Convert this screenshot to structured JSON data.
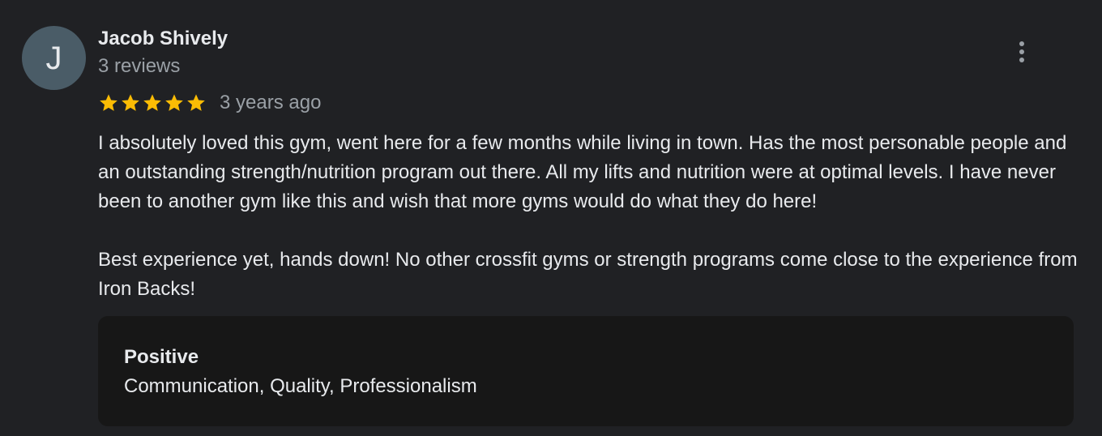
{
  "reviewer": {
    "initial": "J",
    "name": "Jacob Shively",
    "review_count": "3 reviews",
    "avatar_color": "#4a5c67"
  },
  "rating": {
    "stars": 5,
    "max_stars": 5,
    "star_color": "#fbbc04",
    "date": "3 years ago"
  },
  "review": {
    "paragraphs": [
      "I absolutely loved this gym, went here for a few months while living in town. Has the most personable people and an outstanding strength/nutrition program out there. All my lifts and nutrition were at optimal levels. I have never been to another gym like this and wish that more gyms would do what they do here!",
      "Best experience yet, hands down! No other crossfit gyms or strength programs come close to the experience from Iron Backs!"
    ]
  },
  "highlight": {
    "title": "Positive",
    "value": "Communication, Quality, Professionalism"
  },
  "menu": {
    "icon": "more-vertical-icon"
  }
}
